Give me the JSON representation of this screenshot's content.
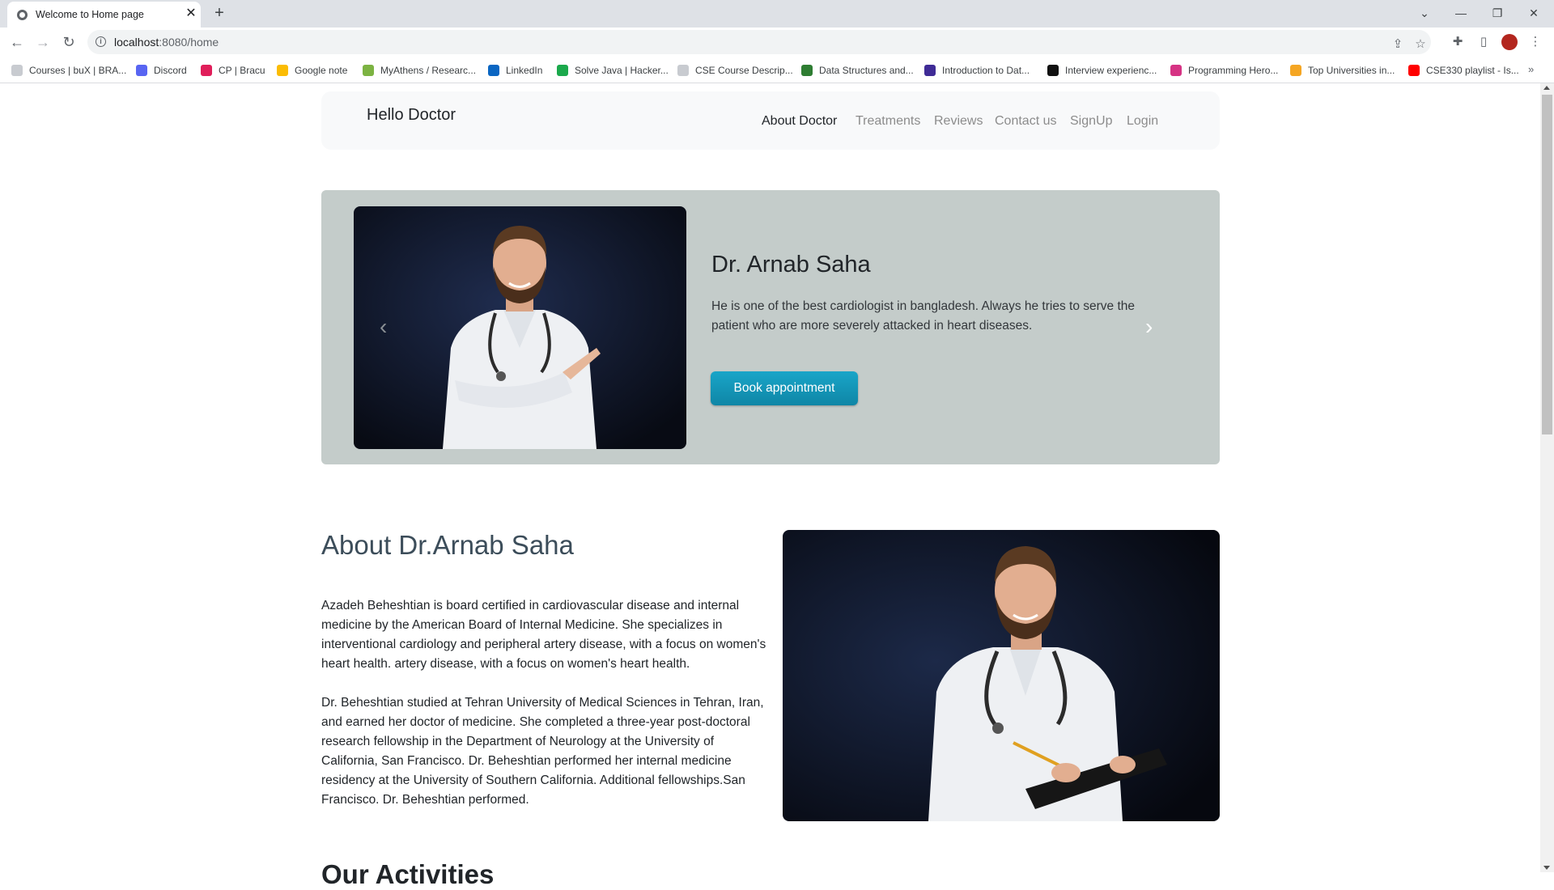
{
  "browser": {
    "tab_title": "Welcome to Home page",
    "url_host": "localhost",
    "url_path": ":8080/home",
    "bookmarks": [
      {
        "label": "Courses | buX | BRA...",
        "color": "#c8cbd0"
      },
      {
        "label": "Discord",
        "color": "#5865f2"
      },
      {
        "label": "CP | Bracu",
        "color": "#e01e5a"
      },
      {
        "label": "Google note",
        "color": "#fbbc04"
      },
      {
        "label": "MyAthens / Researc...",
        "color": "#7cb342"
      },
      {
        "label": "LinkedIn",
        "color": "#0a66c2"
      },
      {
        "label": "Solve Java | Hacker...",
        "color": "#1ba94c"
      },
      {
        "label": "CSE Course Descrip...",
        "color": "#c8cbd0"
      },
      {
        "label": "Data Structures and...",
        "color": "#2e7d32"
      },
      {
        "label": "Introduction to Dat...",
        "color": "#3f2b96"
      },
      {
        "label": "Interview experienc...",
        "color": "#111111"
      },
      {
        "label": "Programming Hero...",
        "color": "#d63384"
      },
      {
        "label": "Top Universities in...",
        "color": "#f5a623"
      },
      {
        "label": "CSE330 playlist - Is...",
        "color": "#ff0000"
      }
    ],
    "bookmarks_more": "»"
  },
  "nav": {
    "brand": "Hello Doctor",
    "links": [
      "About Doctor",
      "Treatments",
      "Reviews",
      "Contact us",
      "SignUp",
      "Login"
    ],
    "active_color": "#212529",
    "muted_color": "#8c8c8c"
  },
  "hero": {
    "name": "Dr. Arnab Saha",
    "description": "He is one of the best cardiologist in bangladesh. Always he tries to serve the patient who are more severely attacked in heart diseases.",
    "button": "Book appointment",
    "prev_icon": "chevron-left-icon",
    "next_icon": "chevron-right-icon",
    "background": "#c4ccca",
    "button_color": "#1396b8"
  },
  "about": {
    "title": "About Dr.Arnab Saha",
    "paragraph1": "Azadeh Beheshtian is board certified in cardiovascular disease and internal medicine by the American Board of Internal Medicine. She specializes in interventional cardiology and peripheral artery disease, with a focus on women's heart health. artery disease, with a focus on women's heart health.",
    "paragraph2": "Dr. Beheshtian studied at Tehran University of Medical Sciences in Tehran, Iran, and earned her doctor of medicine. She completed a three-year post-doctoral research fellowship in the Department of Neurology at the University of California, San Francisco. Dr. Beheshtian performed her internal medicine residency at the University of Southern California. Additional fellowships.San Francisco. Dr. Beheshtian performed.",
    "next_section_heading": "Our Activities"
  }
}
